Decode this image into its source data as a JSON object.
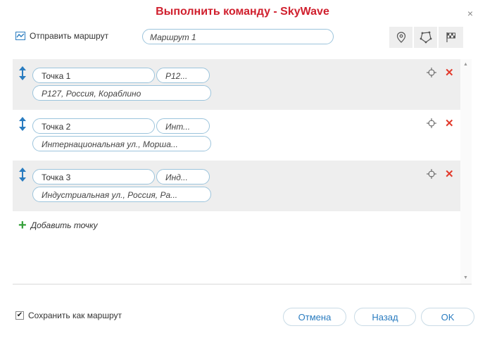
{
  "dialog": {
    "title": "Выполнить команду - SkyWave",
    "close_glyph": "×"
  },
  "send_route": {
    "label": "Отправить маршрут",
    "icon": "route-map-icon",
    "route_name": "Маршрут 1"
  },
  "toolbar": {
    "buttons": [
      {
        "icon": "location-pin-icon"
      },
      {
        "icon": "polygon-icon"
      },
      {
        "icon": "finish-flag-icon"
      }
    ]
  },
  "points": [
    {
      "name": "Точка 1",
      "short": "Р12...",
      "address": "Р127, Россия, Кораблино"
    },
    {
      "name": "Точка 2",
      "short": "Инт...",
      "address": "Интернациональная ул., Морша..."
    },
    {
      "name": "Точка 3",
      "short": "Инд...",
      "address": "Индустриальная ул., Россия, Ра..."
    }
  ],
  "add_point": {
    "label": "Добавить точку"
  },
  "footer": {
    "save_as_route_label": "Сохранить как маршрут",
    "save_as_route_checked": true,
    "cancel_label": "Отмена",
    "back_label": "Назад",
    "ok_label": "OK"
  },
  "colors": {
    "title": "#d0202e",
    "accent": "#2a7cc0",
    "remove": "#e23a2c",
    "add": "#35a03a"
  }
}
